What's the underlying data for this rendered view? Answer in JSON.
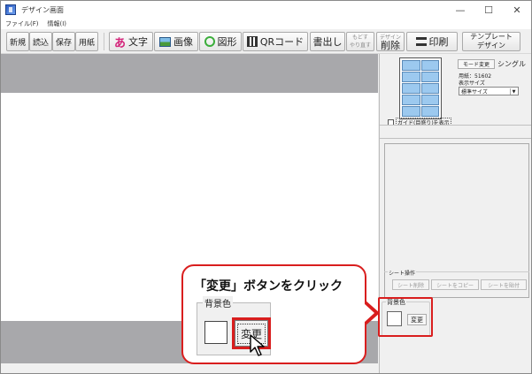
{
  "window": {
    "title": "デザイン画面",
    "minimize": "—",
    "maximize": "☐",
    "close": "✕"
  },
  "menu": [
    "ファイル(F)",
    "情報(I)"
  ],
  "toolbar": {
    "new": "新規",
    "open": "読込",
    "save": "保存",
    "paper": "用紙",
    "text": "文字",
    "text_icon": "あ",
    "image": "画像",
    "shape": "図形",
    "qr": "QRコード",
    "export": "書出し",
    "undo_redo": [
      "もどす",
      "やり直す"
    ],
    "design_delete_small": "デザイン",
    "design_delete": "削除",
    "print": "印刷",
    "template": [
      "テンプレート",
      "デザイン"
    ]
  },
  "right_panel": {
    "mode_button": "モード変更",
    "mode_value": "シングル",
    "paper": "用紙：51602",
    "size_label": "表示サイズ",
    "size_value": "標準サイズ",
    "guide_label": "ガイド(目盛り)を表示",
    "sheet_group_label": "シート操作",
    "sheet_buttons": [
      "シート削除",
      "シートをコピー",
      "シートを貼付"
    ],
    "bg_label": "背景色",
    "bg_button": "変更"
  },
  "callout": {
    "text": "「変更」ボタンをクリック",
    "bg_label": "背景色",
    "button": "変更"
  },
  "colors": {
    "accent": "#d91e1e",
    "canvas_gray": "#a8a8ab",
    "sheet_cell": "#9cc9ef"
  }
}
